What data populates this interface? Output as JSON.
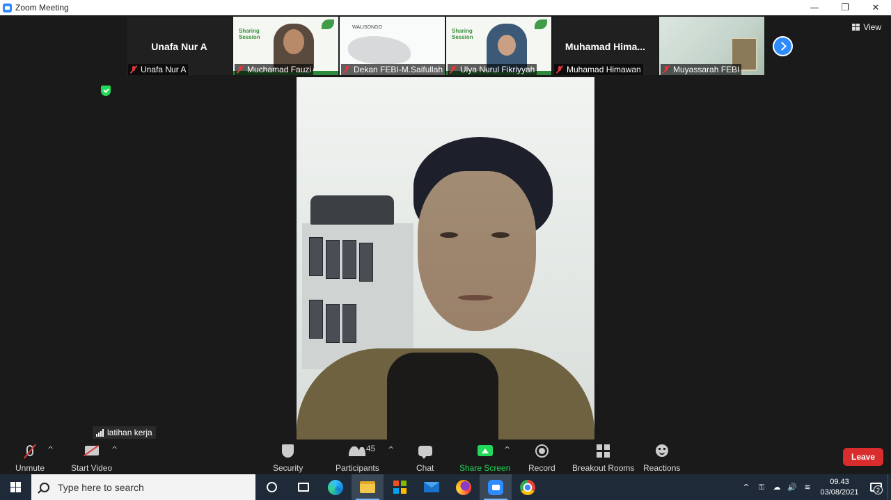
{
  "window": {
    "title": "Zoom Meeting",
    "controls": [
      "—",
      "❐",
      "✕"
    ]
  },
  "gallery": {
    "tiles": [
      {
        "name": "Unafa Nur A",
        "display_name": "Unafa Nur A",
        "kind": "name"
      },
      {
        "name": "Muchamad Fauzi",
        "kind": "video-slide"
      },
      {
        "name": "Dekan FEBI-M.Saifullah",
        "kind": "video-map",
        "slide_text": "WALISONGO"
      },
      {
        "name": "Ulya Nurul Fikriyyah",
        "kind": "video-slide"
      },
      {
        "name": "Muhamad Himawan",
        "display_name": "Muhamad  Hima...",
        "kind": "name"
      },
      {
        "name": "Muyassarah FEBI",
        "kind": "video-room"
      }
    ],
    "slide_text": "Sharing\nSession",
    "view_label": "View"
  },
  "speaker": {
    "name": "latihan kerja"
  },
  "toolbar": {
    "unmute": "Unmute",
    "start_video": "Start Video",
    "security": "Security",
    "participants": "Participants",
    "participants_count": "45",
    "chat": "Chat",
    "share_screen": "Share Screen",
    "record": "Record",
    "breakout_rooms": "Breakout Rooms",
    "reactions": "Reactions",
    "leave": "Leave"
  },
  "taskbar": {
    "search_placeholder": "Type here to search",
    "clock_time": "09.43",
    "clock_date": "03/08/2021",
    "notification_count": "2"
  },
  "colors": {
    "accent": "#2d8cff",
    "share_green": "#23d959",
    "leave_red": "#d92d2d",
    "muted_red": "#e0383b"
  }
}
